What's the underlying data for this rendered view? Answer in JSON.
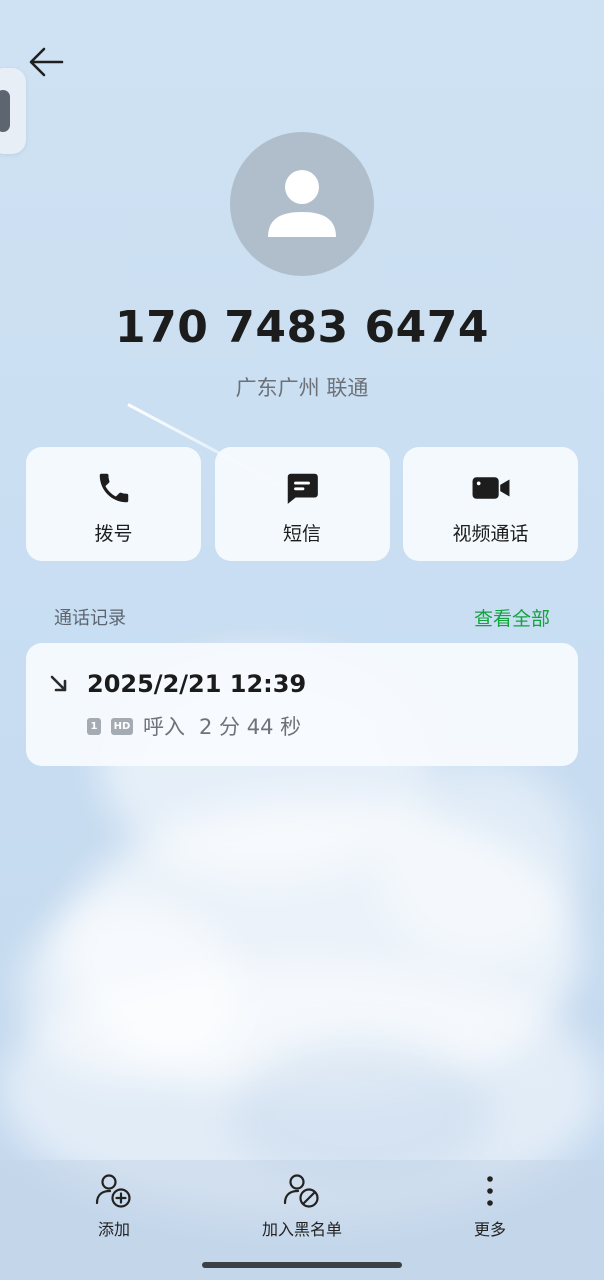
{
  "contact": {
    "phone_number": "170 7483 6474",
    "location": "广东广州 联通"
  },
  "actions": [
    {
      "label": "拨号",
      "icon": "phone-icon"
    },
    {
      "label": "短信",
      "icon": "message-icon"
    },
    {
      "label": "视频通话",
      "icon": "video-camera-icon"
    }
  ],
  "call_log": {
    "title": "通话记录",
    "view_all": "查看全部",
    "entries": [
      {
        "datetime": "2025/2/21 12:39",
        "sim": "1",
        "hd": "HD",
        "type": "呼入",
        "duration": "2 分 44 秒",
        "icon": "incoming-call-arrow-icon"
      }
    ]
  },
  "bottom_bar": [
    {
      "label": "添加",
      "icon": "add-contact-icon"
    },
    {
      "label": "加入黑名单",
      "icon": "block-contact-icon"
    },
    {
      "label": "更多",
      "icon": "more-vertical-icon"
    }
  ],
  "colors": {
    "accent_green": "#14a33f",
    "avatar_bg": "#b0becb",
    "background": "#cfe2f3"
  }
}
